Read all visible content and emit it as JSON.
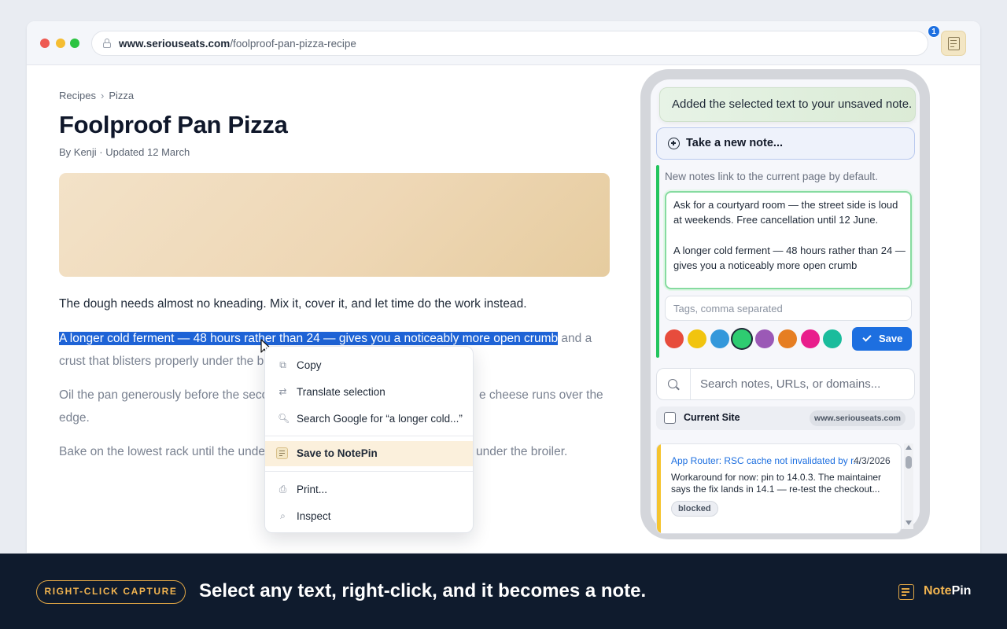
{
  "browser": {
    "url_domain": "www.seriouseats.com",
    "url_path": "/foolproof-pan-pizza-recipe",
    "extension_badge": "1"
  },
  "article": {
    "breadcrumb": [
      "Recipes",
      "Pizza"
    ],
    "breadcrumb_sep": "›",
    "title": "Foolproof Pan Pizza",
    "byline": "By Kenji · Updated 12 March",
    "p1": "The dough needs almost no kneading. Mix it, cover it, and let time do the work instead.",
    "p2_selected": "A longer cold ferment — 48 hours rather than 24 — gives you a noticeably more open crumb",
    "p2_rest_line1": " and a",
    "p2_line2": "crust that blisters properly under the b",
    "p3_line1_left": "Oil the pan generously before the seco",
    "p3_line1_right": "e cheese runs over the",
    "p3_line2": "edge.",
    "p4_left": "Bake on the lowest rack until the unde",
    "p4_right": "under the broiler."
  },
  "context_menu": {
    "items": [
      {
        "label": "Copy",
        "icon": "copy-icon"
      },
      {
        "label": "Translate selection",
        "icon": "translate-icon"
      },
      {
        "label": "Search Google for “a longer cold...”",
        "icon": "search-icon"
      },
      {
        "label": "Save to NotePin",
        "icon": "notepin-icon"
      },
      {
        "label": "Print...",
        "icon": "print-icon"
      },
      {
        "label": "Inspect",
        "icon": "inspect-icon"
      }
    ]
  },
  "popup": {
    "toast": "Added the selected text to your unsaved note.",
    "take_note": "Take a new note...",
    "hint": "New notes link to the current page by default.",
    "note_lines": [
      "Ask for a courtyard room — the street side is loud",
      "at weekends. Free cancellation until 12 June.",
      "A longer cold ferment — 48 hours rather than 24 —",
      "gives you a noticeably more open crumb"
    ],
    "tags_placeholder": "Tags, comma separated",
    "colors": [
      "#e74c3c",
      "#f1c40f",
      "#3498db",
      "#2ecc71",
      "#9b59b6",
      "#e67e22",
      "#e91e8c",
      "#1abc9c"
    ],
    "selected_color": "#2ecc71",
    "save_label": "Save",
    "search_placeholder": "Search notes, URLs, or domains...",
    "current_site_label": "Current Site",
    "current_site_domain": "www.seriouseats.com",
    "card": {
      "title": "App Router: RSC cache not invalidated by r...",
      "date": "4/3/2026",
      "line1": "Workaround for now: pin to 14.0.3. The maintainer",
      "line2": "says the fix lands in 14.1 — re-test the checkout...",
      "tag": "blocked",
      "accent": "#f5c430"
    }
  },
  "footer": {
    "chip": "RIGHT-CLICK CAPTURE",
    "tagline": "Select any text, right-click, and it becomes a note.",
    "brand_a": "Note",
    "brand_b": "Pin"
  }
}
